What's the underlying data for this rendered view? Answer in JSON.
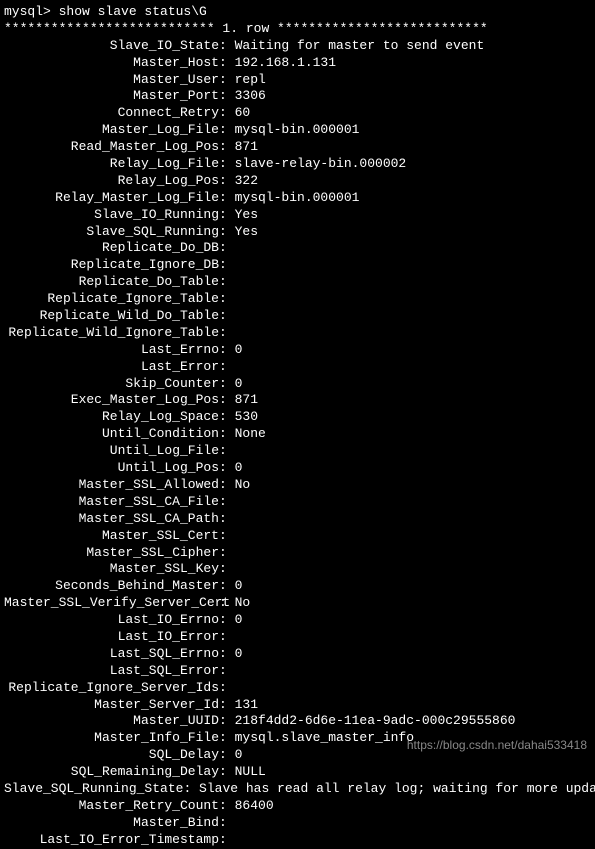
{
  "prompt": "mysql> show slave status\\G",
  "row_separator": "*************************** 1. row ***************************",
  "watermark": "https://blog.csdn.net/dahai533418",
  "fields": [
    {
      "key": "Slave_IO_State",
      "value": "Waiting for master to send event"
    },
    {
      "key": "Master_Host",
      "value": "192.168.1.131"
    },
    {
      "key": "Master_User",
      "value": "repl"
    },
    {
      "key": "Master_Port",
      "value": "3306"
    },
    {
      "key": "Connect_Retry",
      "value": "60"
    },
    {
      "key": "Master_Log_File",
      "value": "mysql-bin.000001"
    },
    {
      "key": "Read_Master_Log_Pos",
      "value": "871"
    },
    {
      "key": "Relay_Log_File",
      "value": "slave-relay-bin.000002"
    },
    {
      "key": "Relay_Log_Pos",
      "value": "322"
    },
    {
      "key": "Relay_Master_Log_File",
      "value": "mysql-bin.000001"
    },
    {
      "key": "Slave_IO_Running",
      "value": "Yes"
    },
    {
      "key": "Slave_SQL_Running",
      "value": "Yes"
    },
    {
      "key": "Replicate_Do_DB",
      "value": ""
    },
    {
      "key": "Replicate_Ignore_DB",
      "value": ""
    },
    {
      "key": "Replicate_Do_Table",
      "value": ""
    },
    {
      "key": "Replicate_Ignore_Table",
      "value": ""
    },
    {
      "key": "Replicate_Wild_Do_Table",
      "value": ""
    },
    {
      "key": "Replicate_Wild_Ignore_Table",
      "value": ""
    },
    {
      "key": "Last_Errno",
      "value": "0"
    },
    {
      "key": "Last_Error",
      "value": ""
    },
    {
      "key": "Skip_Counter",
      "value": "0"
    },
    {
      "key": "Exec_Master_Log_Pos",
      "value": "871"
    },
    {
      "key": "Relay_Log_Space",
      "value": "530"
    },
    {
      "key": "Until_Condition",
      "value": "None"
    },
    {
      "key": "Until_Log_File",
      "value": ""
    },
    {
      "key": "Until_Log_Pos",
      "value": "0"
    },
    {
      "key": "Master_SSL_Allowed",
      "value": "No"
    },
    {
      "key": "Master_SSL_CA_File",
      "value": ""
    },
    {
      "key": "Master_SSL_CA_Path",
      "value": ""
    },
    {
      "key": "Master_SSL_Cert",
      "value": ""
    },
    {
      "key": "Master_SSL_Cipher",
      "value": ""
    },
    {
      "key": "Master_SSL_Key",
      "value": ""
    },
    {
      "key": "Seconds_Behind_Master",
      "value": "0"
    },
    {
      "key": "Master_SSL_Verify_Server_Cert",
      "value": "No"
    },
    {
      "key": "Last_IO_Errno",
      "value": "0"
    },
    {
      "key": "Last_IO_Error",
      "value": ""
    },
    {
      "key": "Last_SQL_Errno",
      "value": "0"
    },
    {
      "key": "Last_SQL_Error",
      "value": ""
    },
    {
      "key": "Replicate_Ignore_Server_Ids",
      "value": ""
    },
    {
      "key": "Master_Server_Id",
      "value": "131"
    },
    {
      "key": "Master_UUID",
      "value": "218f4dd2-6d6e-11ea-9adc-000c29555860"
    },
    {
      "key": "Master_Info_File",
      "value": "mysql.slave_master_info"
    },
    {
      "key": "SQL_Delay",
      "value": "0"
    },
    {
      "key": "SQL_Remaining_Delay",
      "value": "NULL"
    },
    {
      "key": "Slave_SQL_Running_State",
      "value": "Slave has read all relay log; waiting for more updates"
    },
    {
      "key": "Master_Retry_Count",
      "value": "86400"
    },
    {
      "key": "Master_Bind",
      "value": ""
    },
    {
      "key": "Last_IO_Error_Timestamp",
      "value": ""
    }
  ]
}
